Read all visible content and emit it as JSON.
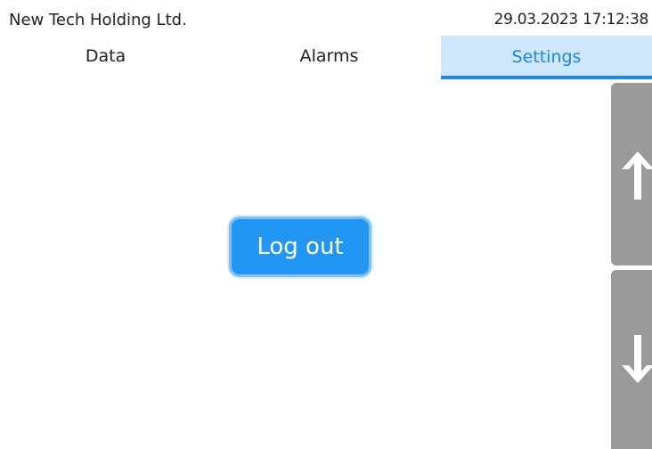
{
  "header": {
    "company": "New Tech Holding Ltd.",
    "datetime": "29.03.2023 17:12:38"
  },
  "tabs": [
    {
      "label": "Data",
      "active": false
    },
    {
      "label": "Alarms",
      "active": false
    },
    {
      "label": "Settings",
      "active": true
    }
  ],
  "main": {
    "logout_label": "Log out"
  },
  "scroll": {
    "up_icon": "arrow-up-icon",
    "down_icon": "arrow-down-icon"
  },
  "colors": {
    "accent": "#2196f3",
    "active_tab_bg": "#cfe7fc",
    "active_tab_text": "#1a86e6",
    "scroll_button": "#9a9a9a"
  }
}
